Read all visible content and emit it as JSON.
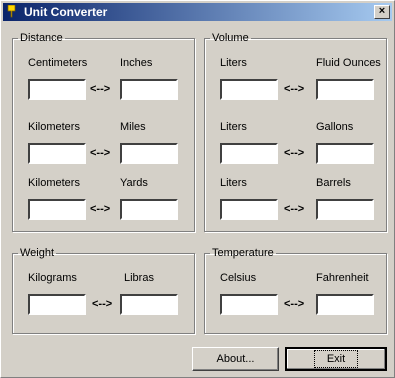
{
  "window": {
    "title": "Unit Converter",
    "icon": "app-icon",
    "close_label": "×"
  },
  "groups": {
    "distance": {
      "legend": "Distance",
      "rows": [
        {
          "left_label": "Centimeters",
          "right_label": "Inches",
          "left_value": "",
          "right_value": ""
        },
        {
          "left_label": "Kilometers",
          "right_label": "Miles",
          "left_value": "",
          "right_value": ""
        },
        {
          "left_label": "Kilometers",
          "right_label": "Yards",
          "left_value": "",
          "right_value": ""
        }
      ]
    },
    "volume": {
      "legend": "Volume",
      "rows": [
        {
          "left_label": "Liters",
          "right_label": "Fluid Ounces",
          "left_value": "",
          "right_value": ""
        },
        {
          "left_label": "Liters",
          "right_label": "Gallons",
          "left_value": "",
          "right_value": ""
        },
        {
          "left_label": "Liters",
          "right_label": "Barrels",
          "left_value": "",
          "right_value": ""
        }
      ]
    },
    "weight": {
      "legend": "Weight",
      "rows": [
        {
          "left_label": "Kilograms",
          "right_label": "Libras",
          "left_value": "",
          "right_value": ""
        }
      ]
    },
    "temperature": {
      "legend": "Temperature",
      "rows": [
        {
          "left_label": "Celsius",
          "right_label": "Fahrenheit",
          "left_value": "",
          "right_value": ""
        }
      ]
    }
  },
  "arrow_text": "<-->",
  "buttons": {
    "about": "About...",
    "exit": "Exit"
  }
}
